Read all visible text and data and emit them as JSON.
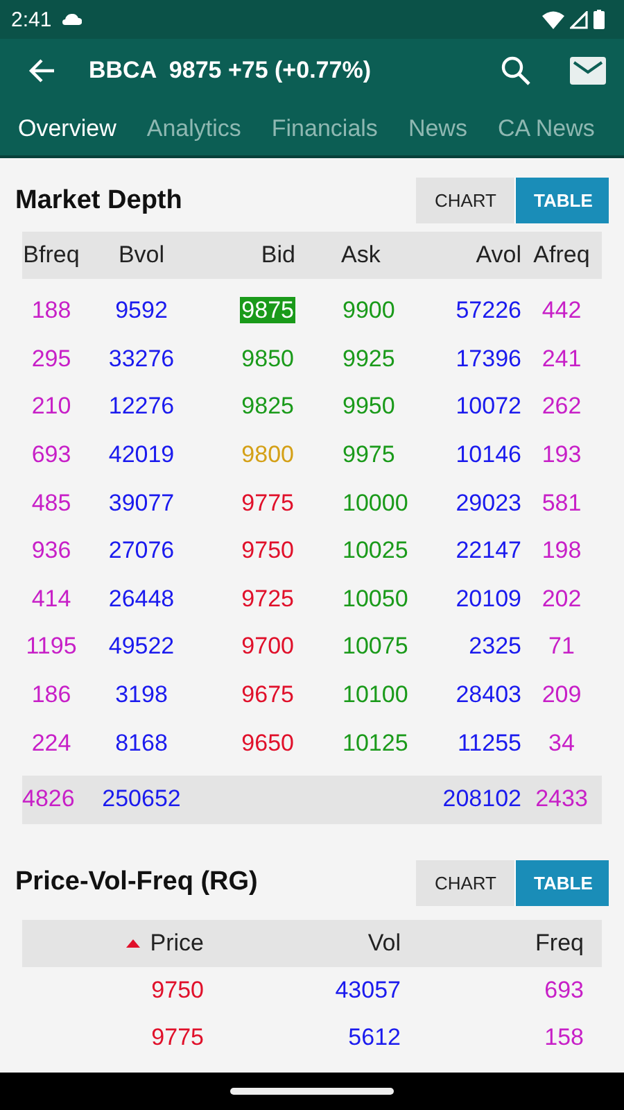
{
  "status_bar": {
    "time": "2:41"
  },
  "app_bar": {
    "title": "BBCA  9875 +75 (+0.77%)"
  },
  "tabs": [
    {
      "label": "Overview",
      "selected": true
    },
    {
      "label": "Analytics",
      "selected": false
    },
    {
      "label": "Financials",
      "selected": false
    },
    {
      "label": "News",
      "selected": false
    },
    {
      "label": "CA News",
      "selected": false
    }
  ],
  "market_depth": {
    "title": "Market Depth",
    "toggle": [
      {
        "label": "CHART",
        "selected": false
      },
      {
        "label": "TABLE",
        "selected": true
      }
    ],
    "columns": [
      "Bfreq",
      "Bvol",
      "Bid",
      "Ask",
      "Avol",
      "Afreq"
    ],
    "rows": [
      {
        "bfreq": "188",
        "bvol": "9592",
        "bid": {
          "text": "9875",
          "color": "#1a9a1a",
          "highlighted": true
        },
        "ask": {
          "text": "9900",
          "color": "#1a9a1a"
        },
        "avol": "57226",
        "afreq": "442"
      },
      {
        "bfreq": "295",
        "bvol": "33276",
        "bid": {
          "text": "9850",
          "color": "#1a9a1a",
          "highlighted": false
        },
        "ask": {
          "text": "9925",
          "color": "#1a9a1a"
        },
        "avol": "17396",
        "afreq": "241"
      },
      {
        "bfreq": "210",
        "bvol": "12276",
        "bid": {
          "text": "9825",
          "color": "#1a9a1a",
          "highlighted": false
        },
        "ask": {
          "text": "9950",
          "color": "#1a9a1a"
        },
        "avol": "10072",
        "afreq": "262"
      },
      {
        "bfreq": "693",
        "bvol": "42019",
        "bid": {
          "text": "9800",
          "color": "#d4a017",
          "highlighted": false
        },
        "ask": {
          "text": "9975",
          "color": "#1a9a1a"
        },
        "avol": "10146",
        "afreq": "193"
      },
      {
        "bfreq": "485",
        "bvol": "39077",
        "bid": {
          "text": "9775",
          "color": "#e0102a",
          "highlighted": false
        },
        "ask": {
          "text": "10000",
          "color": "#1a9a1a"
        },
        "avol": "29023",
        "afreq": "581"
      },
      {
        "bfreq": "936",
        "bvol": "27076",
        "bid": {
          "text": "9750",
          "color": "#e0102a",
          "highlighted": false
        },
        "ask": {
          "text": "10025",
          "color": "#1a9a1a"
        },
        "avol": "22147",
        "afreq": "198"
      },
      {
        "bfreq": "414",
        "bvol": "26448",
        "bid": {
          "text": "9725",
          "color": "#e0102a",
          "highlighted": false
        },
        "ask": {
          "text": "10050",
          "color": "#1a9a1a"
        },
        "avol": "20109",
        "afreq": "202"
      },
      {
        "bfreq": "1195",
        "bvol": "49522",
        "bid": {
          "text": "9700",
          "color": "#e0102a",
          "highlighted": false
        },
        "ask": {
          "text": "10075",
          "color": "#1a9a1a"
        },
        "avol": "2325",
        "afreq": "71"
      },
      {
        "bfreq": "186",
        "bvol": "3198",
        "bid": {
          "text": "9675",
          "color": "#e0102a",
          "highlighted": false
        },
        "ask": {
          "text": "10100",
          "color": "#1a9a1a"
        },
        "avol": "28403",
        "afreq": "209"
      },
      {
        "bfreq": "224",
        "bvol": "8168",
        "bid": {
          "text": "9650",
          "color": "#e0102a",
          "highlighted": false
        },
        "ask": {
          "text": "10125",
          "color": "#1a9a1a"
        },
        "avol": "11255",
        "afreq": "34"
      }
    ],
    "totals": {
      "bfreq": "4826",
      "bvol": "250652",
      "avol": "208102",
      "afreq": "2433"
    }
  },
  "price_vol_freq": {
    "title": "Price-Vol-Freq (RG)",
    "toggle": [
      {
        "label": "CHART",
        "selected": false
      },
      {
        "label": "TABLE",
        "selected": true
      }
    ],
    "columns": [
      {
        "label": "Price",
        "sorted": true
      },
      {
        "label": "Vol",
        "sorted": false
      },
      {
        "label": "Freq",
        "sorted": false
      }
    ],
    "rows": [
      {
        "price": "9750",
        "vol": "43057",
        "freq": "693"
      },
      {
        "price": "9775",
        "vol": "5612",
        "freq": "158"
      }
    ]
  }
}
